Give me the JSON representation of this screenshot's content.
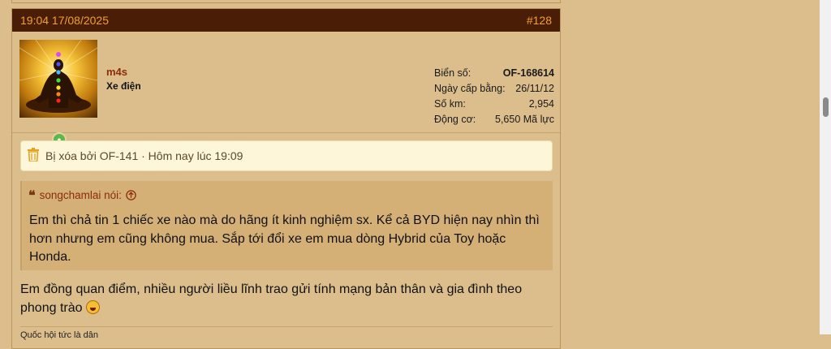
{
  "post": {
    "timestamp": "19:04 17/08/2025",
    "number": "#128",
    "user": {
      "name": "m4s",
      "title": "Xe điện",
      "stats": [
        {
          "label": "Biển số:",
          "value": "OF-168614"
        },
        {
          "label": "Ngày cấp bằng:",
          "value": "26/11/12"
        },
        {
          "label": "Số km:",
          "value": "2,954"
        },
        {
          "label": "Động cơ:",
          "value": "5,650 Mã lực"
        }
      ]
    },
    "deleted_notice": "Bị xóa bởi OF-141 · Hôm nay lúc 19:09",
    "quote": {
      "author_line": "songchamlai nói:",
      "text": "Em thì chả tin 1 chiếc xe nào mà do hãng ít kinh nghiệm sx. Kể cả BYD hiện nay nhìn thì hơn nhưng em cũng không mua. Sắp tới đổi xe em mua dòng Hybrid của Toy hoặc Honda."
    },
    "reply_text": "Em đồng quan điểm, nhiều người liều lĩnh trao gửi tính mạng bản thân và gia đình theo phong trào",
    "signature": "Quốc hội tức là dân"
  },
  "colors": {
    "header_bg": "#4a1e06",
    "header_text": "#f0a030",
    "page_bg": "#dcbe8c",
    "quote_bg": "#d4b077",
    "username": "#8b2c0a"
  }
}
